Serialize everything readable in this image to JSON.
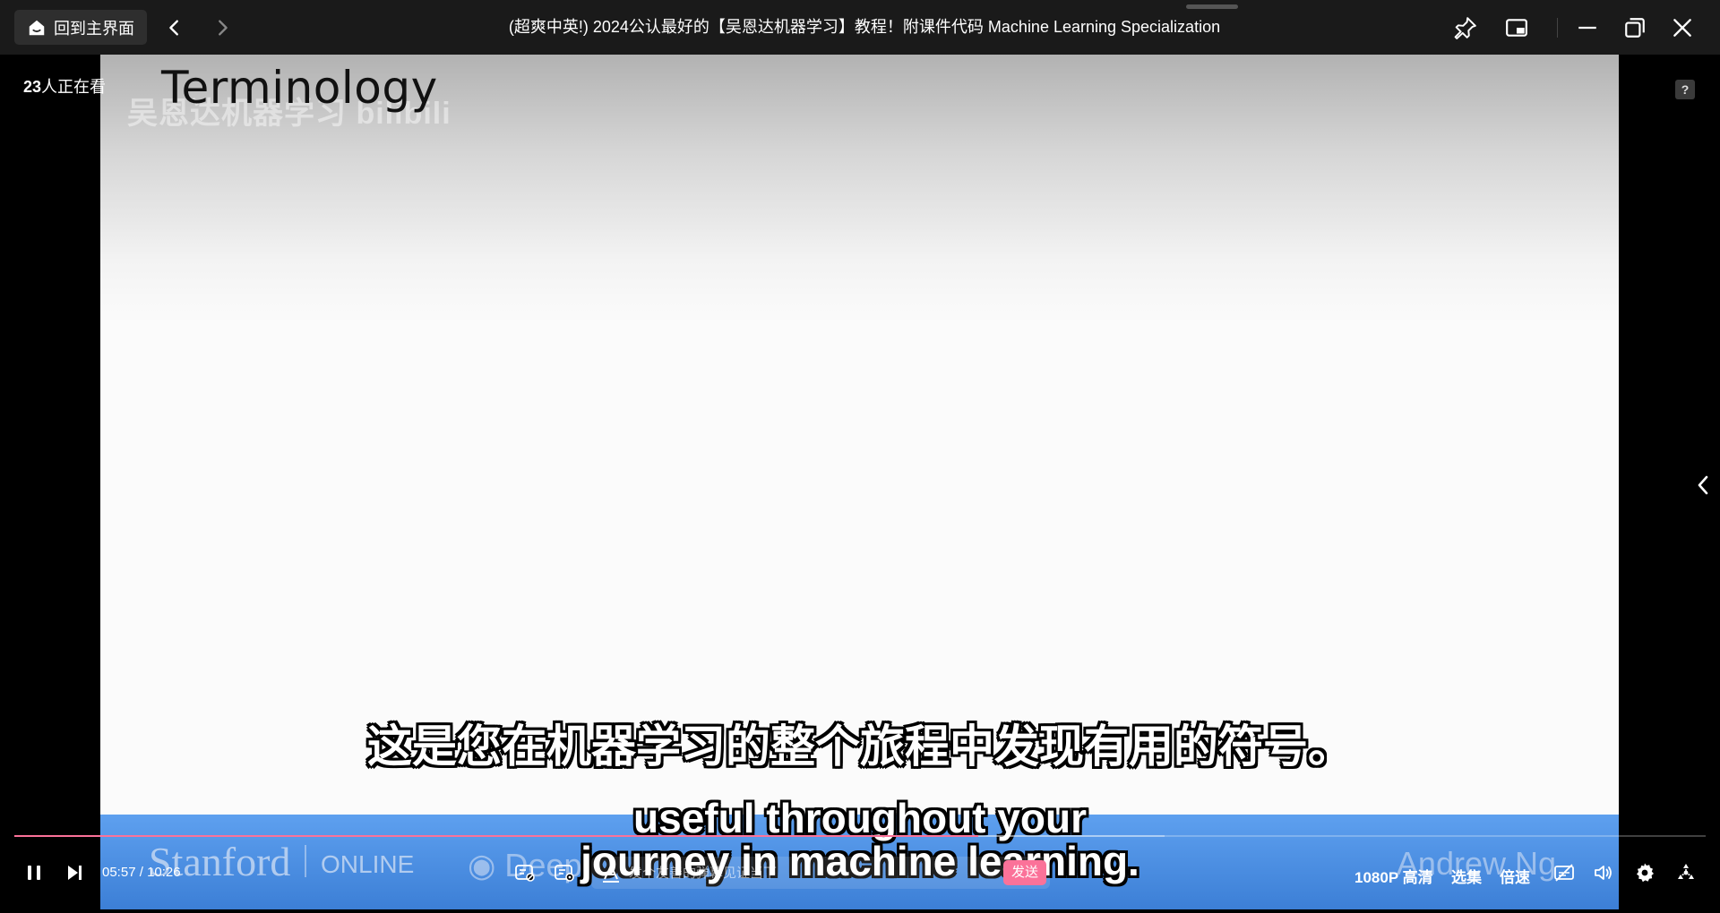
{
  "titlebar": {
    "home_label": "回到主界面",
    "title": "(超爽中英!) 2024公认最好的【吴恩达机器学习】教程！附课件代码 Machine Learning Specialization"
  },
  "video": {
    "slide_title": "Terminology",
    "watermark": "吴恩达机器学习 bilibili",
    "footer": {
      "stanford": "Stanford",
      "online": "ONLINE",
      "deeplearning": "Deep",
      "instructor": "Andrew Ng"
    }
  },
  "overlay": {
    "viewers_count": "23",
    "viewers_suffix": "人正在看"
  },
  "subtitles": {
    "cn": "这是您在机器学习的整个旅程中发现有用的符号。",
    "en_line1": "useful throughout your",
    "en_line2": "journey in machine learning."
  },
  "player": {
    "current_time": "05:57",
    "time_separator": "/",
    "duration": "10:26",
    "progress_fraction": 0.57,
    "buffered_fraction": 0.68,
    "danmaku_placeholder": "发个友善的弹幕见证当下",
    "send_label": "发送",
    "quality_label": "1080P 高清",
    "episodes_label": "选集",
    "speed_label": "倍速"
  },
  "colors": {
    "accent": "#fb7299",
    "titlebar_bg": "#1a1a1a"
  },
  "icons": {
    "home": "home-icon",
    "back": "chevron-left-icon",
    "forward": "chevron-right-icon",
    "pin": "pin-icon",
    "pip": "picture-in-picture-icon",
    "minimize": "minimize-icon",
    "restore": "restore-icon",
    "close": "close-icon",
    "pause": "pause-icon",
    "next": "next-icon",
    "danmaku_toggle": "danmaku-toggle-icon",
    "danmaku_settings": "danmaku-settings-icon",
    "volume": "volume-icon",
    "settings": "gear-icon",
    "fullscreen": "fullscreen-icon"
  }
}
